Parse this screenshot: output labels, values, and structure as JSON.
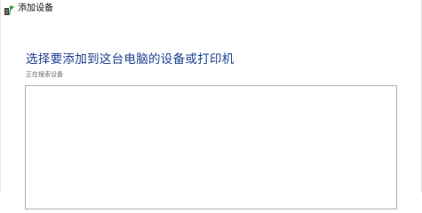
{
  "window": {
    "title": "添加设备",
    "icon": "add-device-icon"
  },
  "main": {
    "heading": "选择要添加到这台电脑的设备或打印机",
    "status": "正在搜索设备"
  },
  "colors": {
    "heading": "#1a3f8f",
    "icon_green": "#2e9e3f",
    "icon_dark": "#3a3a3a"
  },
  "device_list": {
    "items": []
  }
}
